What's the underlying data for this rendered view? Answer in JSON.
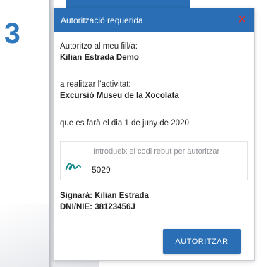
{
  "step": {
    "number": "3"
  },
  "dialog": {
    "title": "Autorització requerida",
    "authorize_text": "Autoritzo al meu fill/a:",
    "child_name": "Kilian Estrada Demo",
    "activity_intro": "a realitzar l'activitat:",
    "activity_name": "Excursió Museu de la Xocolata",
    "date_text": "que es farà el dia 1 de juny de 2020.",
    "code_field": {
      "placeholder": "Introdueix el codi rebut per autoritzar",
      "value": "5029"
    },
    "signer": "Signarà: Kilian Estrada",
    "id_text": "DNI/NIE: 38123456J",
    "submit_label": "AUTORITZAR"
  },
  "colors": {
    "accent": "#2a6fb5",
    "step_number": "#2e78be",
    "close": "#e02b2b",
    "signature_icon": "#1a8a8a"
  },
  "icons": {
    "close": "close-icon",
    "signature": "signature-icon"
  }
}
